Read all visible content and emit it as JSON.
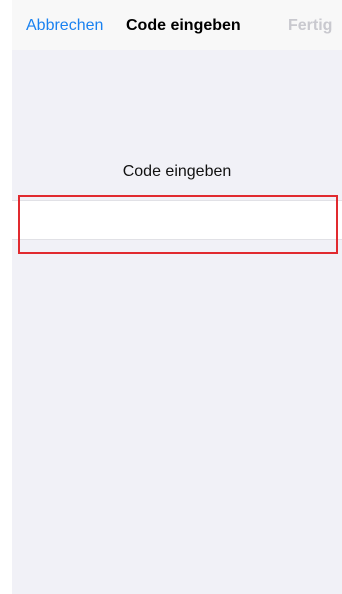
{
  "navbar": {
    "cancel_label": "Abbrechen",
    "title": "Code eingeben",
    "done_label": "Fertig"
  },
  "form": {
    "section_label": "Code eingeben",
    "code_value": "",
    "code_placeholder": ""
  },
  "colors": {
    "accent": "#1a82f0",
    "disabled": "#c9c9cf",
    "highlight": "#e12a2f",
    "background": "#f1f1f7"
  }
}
